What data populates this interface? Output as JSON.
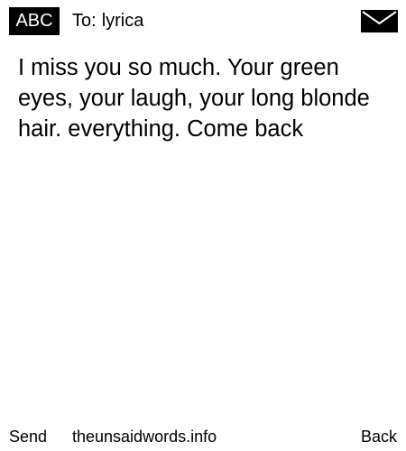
{
  "header": {
    "input_mode": "ABC",
    "to_label": "To:",
    "recipient": "lyrica",
    "icon": "envelope-icon"
  },
  "message": {
    "body": "I miss you so much. Your green eyes, your laugh, your long blonde hair. everything. Come back"
  },
  "footer": {
    "send_label": "Send",
    "site_label": "theunsaidwords.info",
    "back_label": "Back"
  }
}
